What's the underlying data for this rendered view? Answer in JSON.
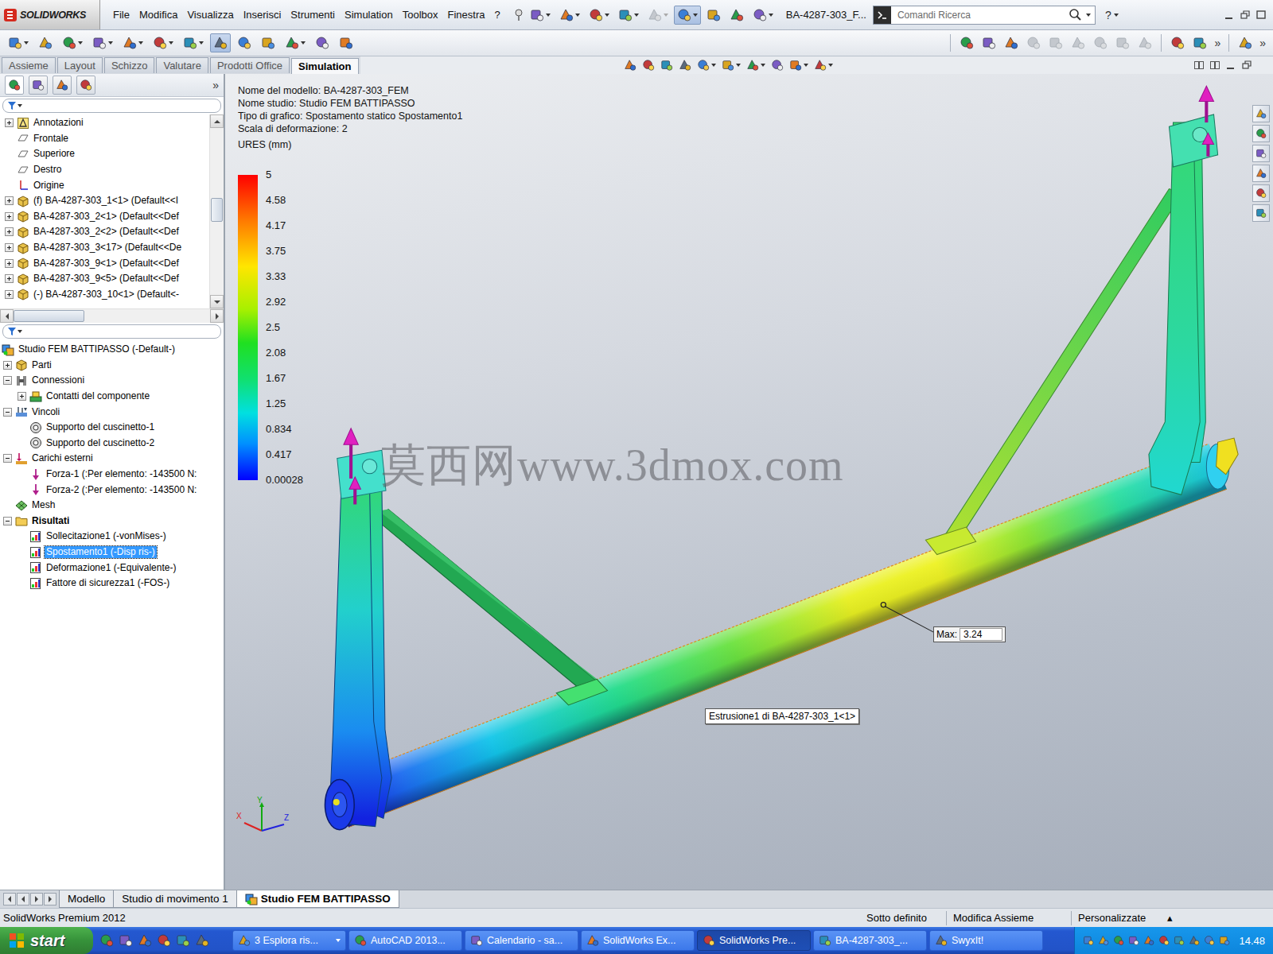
{
  "window": {
    "logo": "SOLIDWORKS",
    "document": "BA-4287-303_F...",
    "search_placeholder": "Comandi Ricerca",
    "help": "?"
  },
  "menus": [
    "File",
    "Modifica",
    "Visualizza",
    "Inserisci",
    "Strumenti",
    "Simulation",
    "Toolbox",
    "Finestra",
    "?"
  ],
  "quick_buttons": [
    {
      "pressed": false,
      "dropdown": true,
      "disabled": false
    },
    {
      "pressed": false,
      "dropdown": true,
      "disabled": false
    },
    {
      "pressed": false,
      "dropdown": true,
      "disabled": false
    },
    {
      "pressed": false,
      "dropdown": true,
      "disabled": false
    },
    {
      "pressed": false,
      "dropdown": true,
      "disabled": true
    },
    {
      "pressed": true,
      "dropdown": true,
      "disabled": false
    },
    {
      "pressed": false,
      "dropdown": false,
      "disabled": false
    },
    {
      "pressed": false,
      "dropdown": false,
      "disabled": false
    },
    {
      "pressed": false,
      "dropdown": true,
      "disabled": false
    }
  ],
  "toolbar": {
    "buttons": [
      {
        "pressed": false,
        "dropdown": true
      },
      {
        "pressed": false,
        "dropdown": false
      },
      {
        "pressed": false,
        "dropdown": true
      },
      {
        "pressed": false,
        "dropdown": true
      },
      {
        "pressed": false,
        "dropdown": true
      },
      {
        "pressed": false,
        "dropdown": true
      },
      {
        "pressed": false,
        "dropdown": true
      },
      {
        "pressed": true,
        "dropdown": false
      },
      {
        "pressed": false,
        "dropdown": false
      },
      {
        "pressed": false,
        "dropdown": false
      },
      {
        "pressed": false,
        "dropdown": true
      },
      {
        "pressed": false,
        "dropdown": false
      },
      {
        "pressed": false,
        "dropdown": false
      }
    ],
    "right_buttons": [
      {
        "disabled": false
      },
      {
        "disabled": false
      },
      {
        "disabled": false
      },
      {
        "disabled": true
      },
      {
        "disabled": true
      },
      {
        "disabled": true
      },
      {
        "disabled": true
      },
      {
        "disabled": true
      },
      {
        "disabled": true
      },
      {
        "disabled": false
      },
      {
        "disabled": false
      },
      {
        "disabled": false
      }
    ],
    "more": "»"
  },
  "command_tabs": [
    {
      "label": "Assieme",
      "selected": false
    },
    {
      "label": "Layout",
      "selected": false
    },
    {
      "label": "Schizzo",
      "selected": false
    },
    {
      "label": "Valutare",
      "selected": false
    },
    {
      "label": "Prodotti Office",
      "selected": false
    },
    {
      "label": "Simulation",
      "selected": true
    }
  ],
  "heads_up": [
    {
      "dropdown": false
    },
    {
      "dropdown": false
    },
    {
      "dropdown": false
    },
    {
      "dropdown": false
    },
    {
      "dropdown": true
    },
    {
      "dropdown": true
    },
    {
      "dropdown": true
    },
    {
      "dropdown": false
    },
    {
      "dropdown": true
    },
    {
      "dropdown": true
    }
  ],
  "panel": {
    "more": "»"
  },
  "feature_tree": [
    {
      "label": "Annotazioni",
      "kind": "annotation",
      "expandable": true,
      "expanded": false
    },
    {
      "label": "Frontale",
      "kind": "plane",
      "expandable": false,
      "expanded": false
    },
    {
      "label": "Superiore",
      "kind": "plane",
      "expandable": false,
      "expanded": false
    },
    {
      "label": "Destro",
      "kind": "plane",
      "expandable": false,
      "expanded": false
    },
    {
      "label": "Origine",
      "kind": "origin",
      "expandable": false,
      "expanded": false
    },
    {
      "label": "(f) BA-4287-303_1<1> (Default<<I",
      "kind": "part",
      "expandable": true,
      "expanded": false
    },
    {
      "label": "BA-4287-303_2<1> (Default<<Def",
      "kind": "part",
      "expandable": true,
      "expanded": false
    },
    {
      "label": "BA-4287-303_2<2> (Default<<Def",
      "kind": "part",
      "expandable": true,
      "expanded": false
    },
    {
      "label": "BA-4287-303_3<17> (Default<<De",
      "kind": "part",
      "expandable": true,
      "expanded": false
    },
    {
      "label": "BA-4287-303_9<1> (Default<<Def",
      "kind": "part",
      "expandable": true,
      "expanded": false
    },
    {
      "label": "BA-4287-303_9<5> (Default<<Def",
      "kind": "part",
      "expandable": true,
      "expanded": false
    },
    {
      "label": "(-) BA-4287-303_10<1> (Default<-",
      "kind": "part",
      "expandable": true,
      "expanded": false
    }
  ],
  "feature_tree_scroll": {
    "vertical_position": 0.42,
    "vertical_size": 0.14,
    "horizontal_position": 0.0,
    "horizontal_size": 0.36
  },
  "study_tree": [
    {
      "label": "Studio FEM BATTIPASSO (-Default-)",
      "depth": 0,
      "kind": "study",
      "expandable": false,
      "expanded": false,
      "selected": false,
      "bold": false
    },
    {
      "label": "Parti",
      "depth": 1,
      "kind": "part",
      "expandable": true,
      "expanded": false,
      "selected": false,
      "bold": false
    },
    {
      "label": "Connessioni",
      "depth": 1,
      "kind": "connection",
      "expandable": true,
      "expanded": true,
      "selected": false,
      "bold": false
    },
    {
      "label": "Contatti del componente",
      "depth": 2,
      "kind": "contact",
      "expandable": true,
      "expanded": false,
      "selected": false,
      "bold": false
    },
    {
      "label": "Vincoli",
      "depth": 1,
      "kind": "fixture-folder",
      "expandable": true,
      "expanded": true,
      "selected": false,
      "bold": false
    },
    {
      "label": "Supporto del cuscinetto-1",
      "depth": 2,
      "kind": "fixture",
      "expandable": false,
      "expanded": false,
      "selected": false,
      "bold": false
    },
    {
      "label": "Supporto del cuscinetto-2",
      "depth": 2,
      "kind": "fixture",
      "expandable": false,
      "expanded": false,
      "selected": false,
      "bold": false
    },
    {
      "label": "Carichi esterni",
      "depth": 1,
      "kind": "load-folder",
      "expandable": true,
      "expanded": true,
      "selected": false,
      "bold": false
    },
    {
      "label": "Forza-1 (:Per elemento: -143500 N:",
      "depth": 2,
      "kind": "load",
      "expandable": false,
      "expanded": false,
      "selected": false,
      "bold": false
    },
    {
      "label": "Forza-2 (:Per elemento: -143500 N:",
      "depth": 2,
      "kind": "load",
      "expandable": false,
      "expanded": false,
      "selected": false,
      "bold": false
    },
    {
      "label": "Mesh",
      "depth": 1,
      "kind": "mesh",
      "expandable": false,
      "expanded": false,
      "selected": false,
      "bold": false
    },
    {
      "label": "Risultati",
      "depth": 1,
      "kind": "folder",
      "expandable": true,
      "expanded": true,
      "selected": false,
      "bold": true
    },
    {
      "label": "Sollecitazione1 (-vonMises-)",
      "depth": 2,
      "kind": "result",
      "expandable": false,
      "expanded": false,
      "selected": false,
      "bold": false
    },
    {
      "label": "Spostamento1 (-Disp ris-)",
      "depth": 2,
      "kind": "result",
      "expandable": false,
      "expanded": false,
      "selected": true,
      "bold": false
    },
    {
      "label": "Deformazione1 (-Equivalente-)",
      "depth": 2,
      "kind": "result",
      "expandable": false,
      "expanded": false,
      "selected": false,
      "bold": false
    },
    {
      "label": "Fattore di sicurezza1 (-FOS-)",
      "depth": 2,
      "kind": "result",
      "expandable": false,
      "expanded": false,
      "selected": false,
      "bold": false
    }
  ],
  "viewport": {
    "info": [
      "Nome del modello: BA-4287-303_FEM",
      "Nome studio: Studio FEM BATTIPASSO",
      "Tipo di grafico: Spostamento statico Spostamento1",
      "Scala di deformazione: 2"
    ],
    "unit": "URES (mm)",
    "legend": [
      "5",
      "4.58",
      "4.17",
      "3.75",
      "3.33",
      "2.92",
      "2.5",
      "2.08",
      "1.67",
      "1.25",
      "0.834",
      "0.417",
      "0.00028"
    ],
    "max_label": "Max:",
    "max_value": "3.24",
    "tooltip": "Estrusione1 di BA-4287-303_1<1>",
    "watermark": "莫西网www.3dmox.com",
    "triad": [
      "X",
      "Y",
      "Z"
    ]
  },
  "bottom_tabs": [
    {
      "label": "Modello",
      "selected": false
    },
    {
      "label": "Studio di movimento 1",
      "selected": false
    },
    {
      "label": "Studio FEM BATTIPASSO",
      "selected": true
    }
  ],
  "status_bar": {
    "product": "SolidWorks Premium 2012",
    "items": [
      "Sotto definito",
      "Modifica Assieme",
      "Personalizzate"
    ],
    "arrow": "▴"
  },
  "taskbar": {
    "start": "start",
    "items": [
      {
        "label": "3 Esplora ris...",
        "selected": false,
        "dropdown": true
      },
      {
        "label": "AutoCAD 2013...",
        "selected": false,
        "dropdown": false
      },
      {
        "label": "Calendario - sa...",
        "selected": false,
        "dropdown": false
      },
      {
        "label": "SolidWorks Ex...",
        "selected": false,
        "dropdown": false
      },
      {
        "label": "SolidWorks Pre...",
        "selected": true,
        "dropdown": false
      },
      {
        "label": "BA-4287-303_...",
        "selected": false,
        "dropdown": false
      },
      {
        "label": "SwyxIt!",
        "selected": false,
        "dropdown": false
      }
    ],
    "time": "14.48"
  }
}
